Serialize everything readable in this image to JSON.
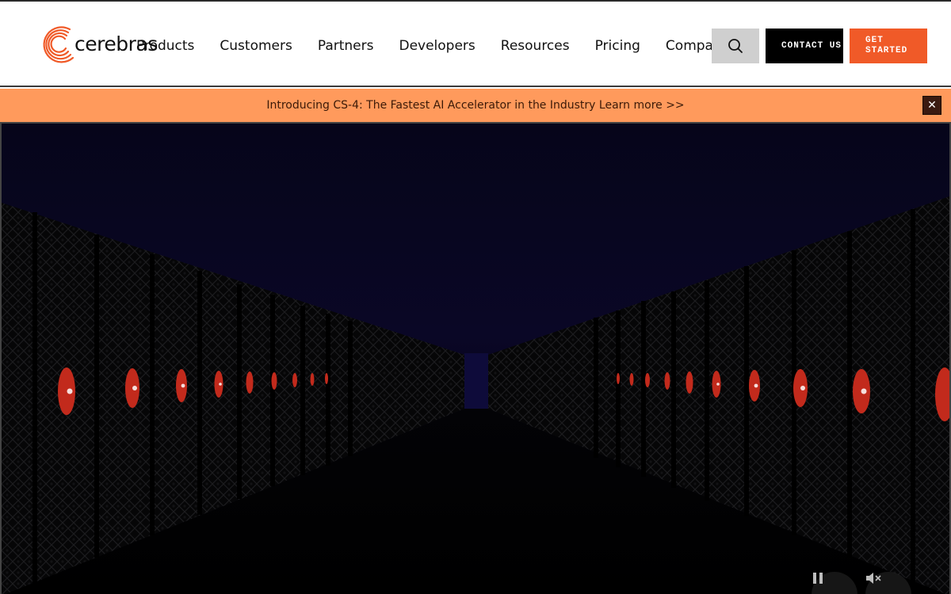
{
  "brand": {
    "name": "cerebras",
    "accent_color": "#f05a28"
  },
  "nav": {
    "items": [
      {
        "label": "Products"
      },
      {
        "label": "Customers"
      },
      {
        "label": "Partners"
      },
      {
        "label": "Developers"
      },
      {
        "label": "Resources"
      },
      {
        "label": "Pricing"
      },
      {
        "label": "Company"
      }
    ],
    "search_icon": "search-icon",
    "contact_label": "CONTACT US",
    "get_started_label": "GET STARTED"
  },
  "banner": {
    "text": "Introducing CS-4: The Fastest AI Accelerator in the Industry Learn more >>",
    "background_color": "#ff9a5c",
    "close_icon": "close-icon"
  },
  "hero": {
    "type": "video",
    "controls": {
      "pause_icon": "pause-icon",
      "mute_icon": "mute-icon"
    }
  }
}
